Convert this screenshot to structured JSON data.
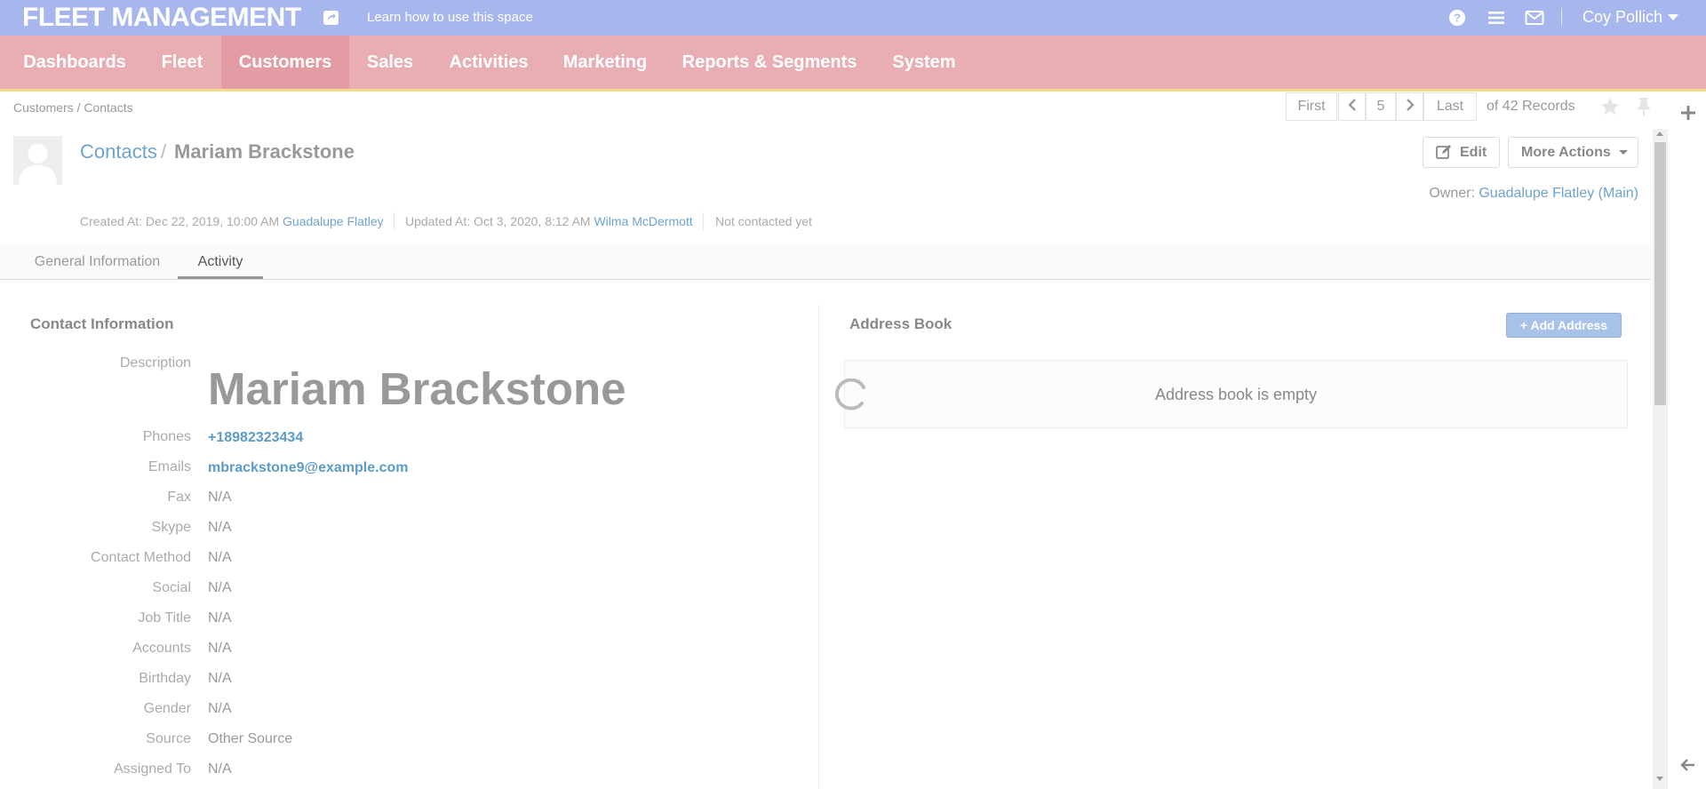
{
  "app": {
    "title": "FLEET MANAGEMENT",
    "learn_link": "Learn how to use this space",
    "user_name": "Coy Pollich",
    "colors": {
      "topbar": "#a8b6ee",
      "nav": "#e8aeb4",
      "nav_active": "#e39ca4",
      "link": "#6ea3cf"
    }
  },
  "nav": {
    "items": [
      {
        "label": "Dashboards"
      },
      {
        "label": "Fleet"
      },
      {
        "label": "Customers",
        "active": true
      },
      {
        "label": "Sales"
      },
      {
        "label": "Activities"
      },
      {
        "label": "Marketing"
      },
      {
        "label": "Reports & Segments"
      },
      {
        "label": "System"
      }
    ]
  },
  "breadcrumb": "Customers / Contacts",
  "pager": {
    "first": "First",
    "current": "5",
    "last": "Last",
    "records": "of 42 Records"
  },
  "header": {
    "section_link": "Contacts",
    "separator": "/",
    "name": "Mariam Brackstone",
    "edit_label": "Edit",
    "more_actions_label": "More Actions",
    "owner_label": "Owner:",
    "owner_value": "Guadalupe Flatley (Main)",
    "created_label": "Created At: Dec 22, 2019, 10:00 AM",
    "created_by": "Guadalupe Flatley",
    "updated_label": "Updated At: Oct 3, 2020, 8:12 AM",
    "updated_by": "Wilma McDermott",
    "contact_status": "Not contacted yet"
  },
  "tabs": [
    {
      "label": "General Information"
    },
    {
      "label": "Activity",
      "active": true
    }
  ],
  "contact_info": {
    "title": "Contact Information",
    "description_label": "Description",
    "description_value": "Mariam Brackstone",
    "fields": [
      {
        "label": "Phones",
        "value": "+18982323434",
        "link": true
      },
      {
        "label": "Emails",
        "value": "mbrackstone9@example.com",
        "link": true
      },
      {
        "label": "Fax",
        "value": "N/A"
      },
      {
        "label": "Skype",
        "value": "N/A"
      },
      {
        "label": "Contact Method",
        "value": "N/A"
      },
      {
        "label": "Social",
        "value": "N/A"
      },
      {
        "label": "Job Title",
        "value": "N/A"
      },
      {
        "label": "Accounts",
        "value": "N/A"
      },
      {
        "label": "Birthday",
        "value": "N/A"
      },
      {
        "label": "Gender",
        "value": "N/A"
      },
      {
        "label": "Source",
        "value": "Other Source"
      },
      {
        "label": "Assigned To",
        "value": "N/A"
      }
    ]
  },
  "address_book": {
    "title": "Address Book",
    "add_label": "+ Add Address",
    "empty_text": "Address book is empty"
  }
}
